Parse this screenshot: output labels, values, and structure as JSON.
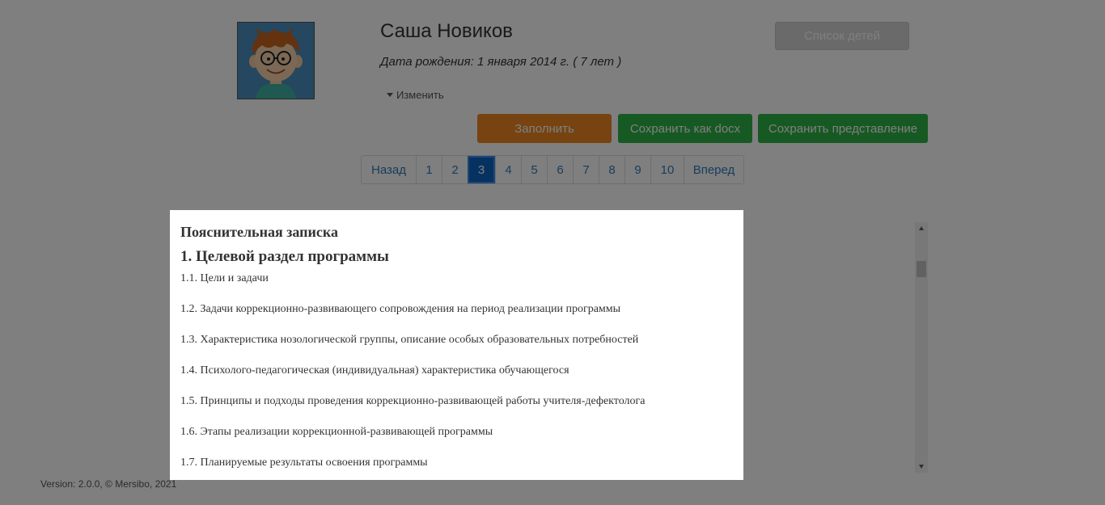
{
  "profile": {
    "name": "Саша Новиков",
    "birth_date": "Дата рождения: 1 января 2014 г. ( 7 лет )",
    "edit_label": "Изменить"
  },
  "header": {
    "children_list_label": "Список детей"
  },
  "actions": {
    "fill_label": "Заполнить",
    "save_docx_label": "Сохранить как docx",
    "save_view_label": "Сохранить представление"
  },
  "pagination": {
    "prev_label": "Назад",
    "next_label": "Вперед",
    "pages": [
      "1",
      "2",
      "3",
      "4",
      "5",
      "6",
      "7",
      "8",
      "9",
      "10"
    ],
    "current": "3"
  },
  "document": {
    "title": "Пояснительная записка",
    "section": "1. Целевой раздел программы",
    "items": [
      "1.1. Цели и задачи",
      "1.2. Задачи коррекционно-развивающего сопровождения на период реализации программы",
      "1.3. Характеристика нозологической группы, описание особых образовательных потребностей",
      "1.4. Психолого-педагогическая (индивидуальная) характеристика обучающегося",
      "1.5. Принципы и подходы проведения коррекционно-развивающей работы учителя-дефектолога",
      "1.6. Этапы реализации коррекционной-развивающей программы",
      "1.7. Планируемые результаты освоения программы"
    ]
  },
  "footer": {
    "version": "Version: 2.0.0, © Mersibo, 2021"
  },
  "colors": {
    "fill_button": "#ee8722",
    "save_button": "#2fb347",
    "active_page": "#0d64c2",
    "link": "#337ab7"
  }
}
